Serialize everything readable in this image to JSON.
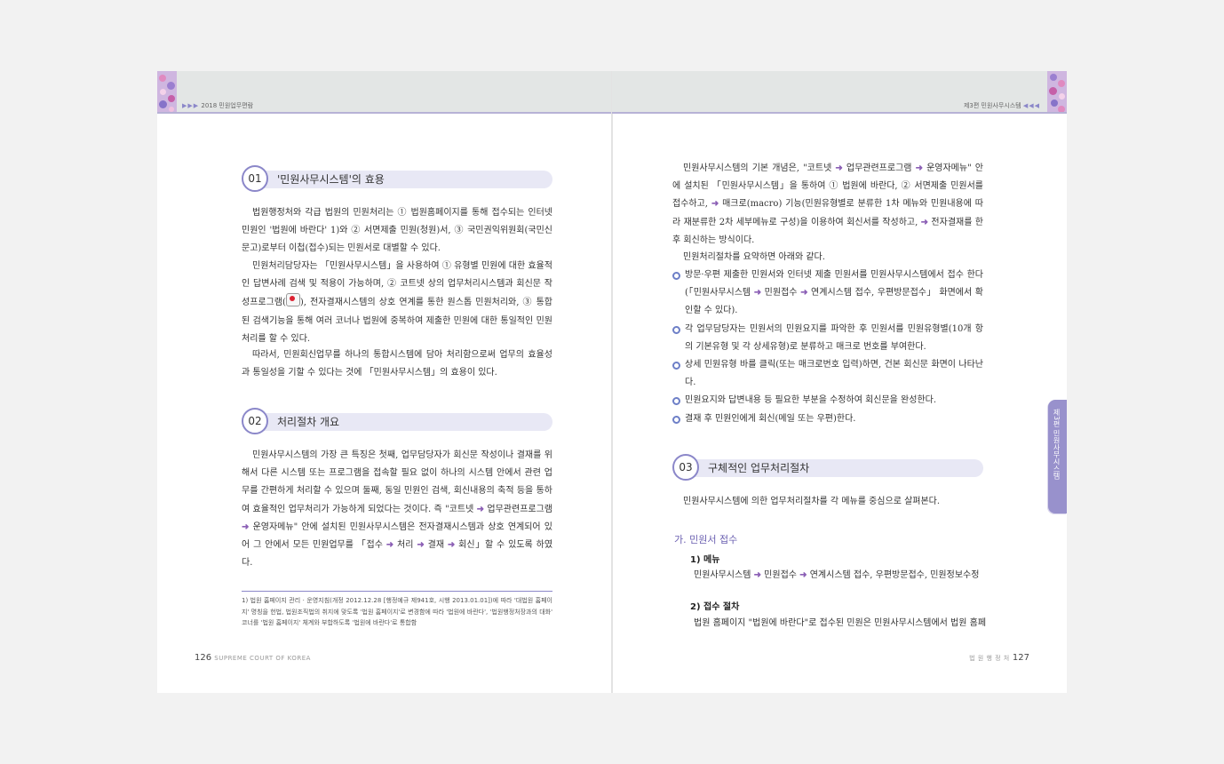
{
  "header": {
    "left_running": "2018 민원업무편람",
    "left_arrows": "▶▶▶",
    "right_running": "제3편 민원사무시스템",
    "right_arrows": "◀◀◀"
  },
  "left_page": {
    "sec1": {
      "num": "01",
      "title": "'민원사무시스템'의 효용"
    },
    "p1": "법원행정처와 각급 법원의 민원처리는 ① 법원홈페이지를 통해 접수되는 인터넷 민원인 '법원에 바란다' 1)와 ② 서면제출 민원(청원)서, ③ 국민권익위원회(국민신문고)로부터 이첩(접수)되는 민원서로 대별할 수 있다.",
    "p2a": "민원처리담당자는 「민원사무시스템」을 사용하여 ① 유형별 민원에 대한 효율적인 답변사례 검색 및 적용이 가능하며, ② 코트넷 상의 업무처리시스템과 회신문 작성프로그램(",
    "p2b": "), 전자결재시스템의 상호 연계를 통한 원스톱 민원처리와, ③ 통합된 검색기능을 통해 여러 코너나 법원에 중복하여 제출한 민원에 대한 통일적인 민원처리를 할 수 있다.",
    "p3": "따라서, 민원회신업무를 하나의 통합시스템에 담아 처리함으로써 업무의 효율성과 통일성을 기할 수 있다는 것에 「민원사무시스템」의 효용이 있다.",
    "sec2": {
      "num": "02",
      "title": "처리절차 개요"
    },
    "p4a": "민원사무시스템의 가장 큰 특징은 첫째, 업무담당자가 회신문 작성이나 결재를 위해서 다른 시스템 또는 프로그램을 접속할 필요 없이 하나의 시스템 안에서 관련 업무를 간편하게 처리할 수 있으며 둘째, 동일 민원인 검색, 회신내용의 축적 등을 통하여 효율적인 업무처리가 가능하게 되었다는 것이다. 즉 \"코트넷 ",
    "p4b": " 업무관련프로그램 ",
    "p4c": " 운영자메뉴\" 안에 설치된 민원사무시스템은 전자결재시스템과 상호 연계되어 있어 그 안에서 모든 민원업무를 「접수 ",
    "p4d": " 처리 ",
    "p4e": " 결재 ",
    "p4f": " 회신」할 수 있도록 하였다.",
    "footnote": "1) 법원 홈페이지 관리 · 운영지침(개정 2012.12.28 [행정예규 제941호, 시행 2013.01.01])에 따라 '대법원 홈페이지' 명칭을 헌법, 법원조직법의 취지에 맞도록 '법원 홈페이지'로 변경함에 따라 '법원에 바란다', '법원행정처장과의 대화' 코너를 '법원 홈페이지' 체계와 부합하도록 '법원에 바란다'로 통합함",
    "folio_num": "126",
    "folio_text": "SUPREME COURT OF KOREA"
  },
  "right_page": {
    "p1a": "민원사무시스템의 기본 개념은, \"코트넷 ",
    "p1b": " 업무관련프로그램 ",
    "p1c": " 운영자메뉴\" 안에 설치된 「민원사무시스템」을 통하여 ① 법원에 바란다, ② 서면제출 민원서를 접수하고, ",
    "p1d": " 매크로(macro) 기능(민원유형별로 분류한 1차 메뉴와 민원내용에 따라 재분류한 2차 세부메뉴로 구성)을 이용하여 회신서를 작성하고, ",
    "p1e": " 전자결재를 한 후 회신하는 방식이다.",
    "p2": "민원처리절차를 요약하면 아래와 같다.",
    "bullets": [
      "방문·우편 제출한 민원서와 인터넷 제출 민원서를 민원사무시스템에서 접수",
      "각 업무담당자는 민원서의 민원요지를 파악한 후 민원서를 민원유형별(10개 항의 기본유형 및 각 상세유형)로 분류하고 매크로 번호를 부여한다.",
      "상세 민원유형 바를 클릭(또는 매크로번호 입력)하면, 건본 회신문 화면이 나타난다.",
      "민원요지와 답변내용 등 필요한 부분을 수정하여 회신문을 완성한다.",
      "결재 후 민원인에게 회신(메일 또는 우편)한다."
    ],
    "bullet1_a": "한다(「민원사무시스템 ",
    "bullet1_b": " 민원접수 ",
    "bullet1_c": " 연계시스템 접수, 우편방문접수」 화면에서 확인할 수 있다).",
    "sec3": {
      "num": "03",
      "title": "구체적인 업무처리절차"
    },
    "p3": "민원사무시스템에 의한 업무처리절차를 각 메뉴를 중심으로 살펴본다.",
    "sub_ga": "가. 민원서 접수",
    "sub1": "1) 메뉴",
    "menu_a": "민원사무시스템 ",
    "menu_b": " 민원접수 ",
    "menu_c": " 연계시스템 접수, 우편방문접수, 민원정보수정",
    "sub2": "2) 접수 절차",
    "p4": "법원 홈페이지 \"법원에 바란다\"로 접수된 민원은 민원사무시스템에서 법원 홈페",
    "folio_text": "법 원 행 정 처",
    "folio_num": "127"
  },
  "side_tab": "제3편 민원사무시스템",
  "arrow_glyph": "➜",
  "colors": {
    "accent": "#8b87c9",
    "section_bar": "#e8e8f5",
    "arrow": "#8b5fb5"
  }
}
